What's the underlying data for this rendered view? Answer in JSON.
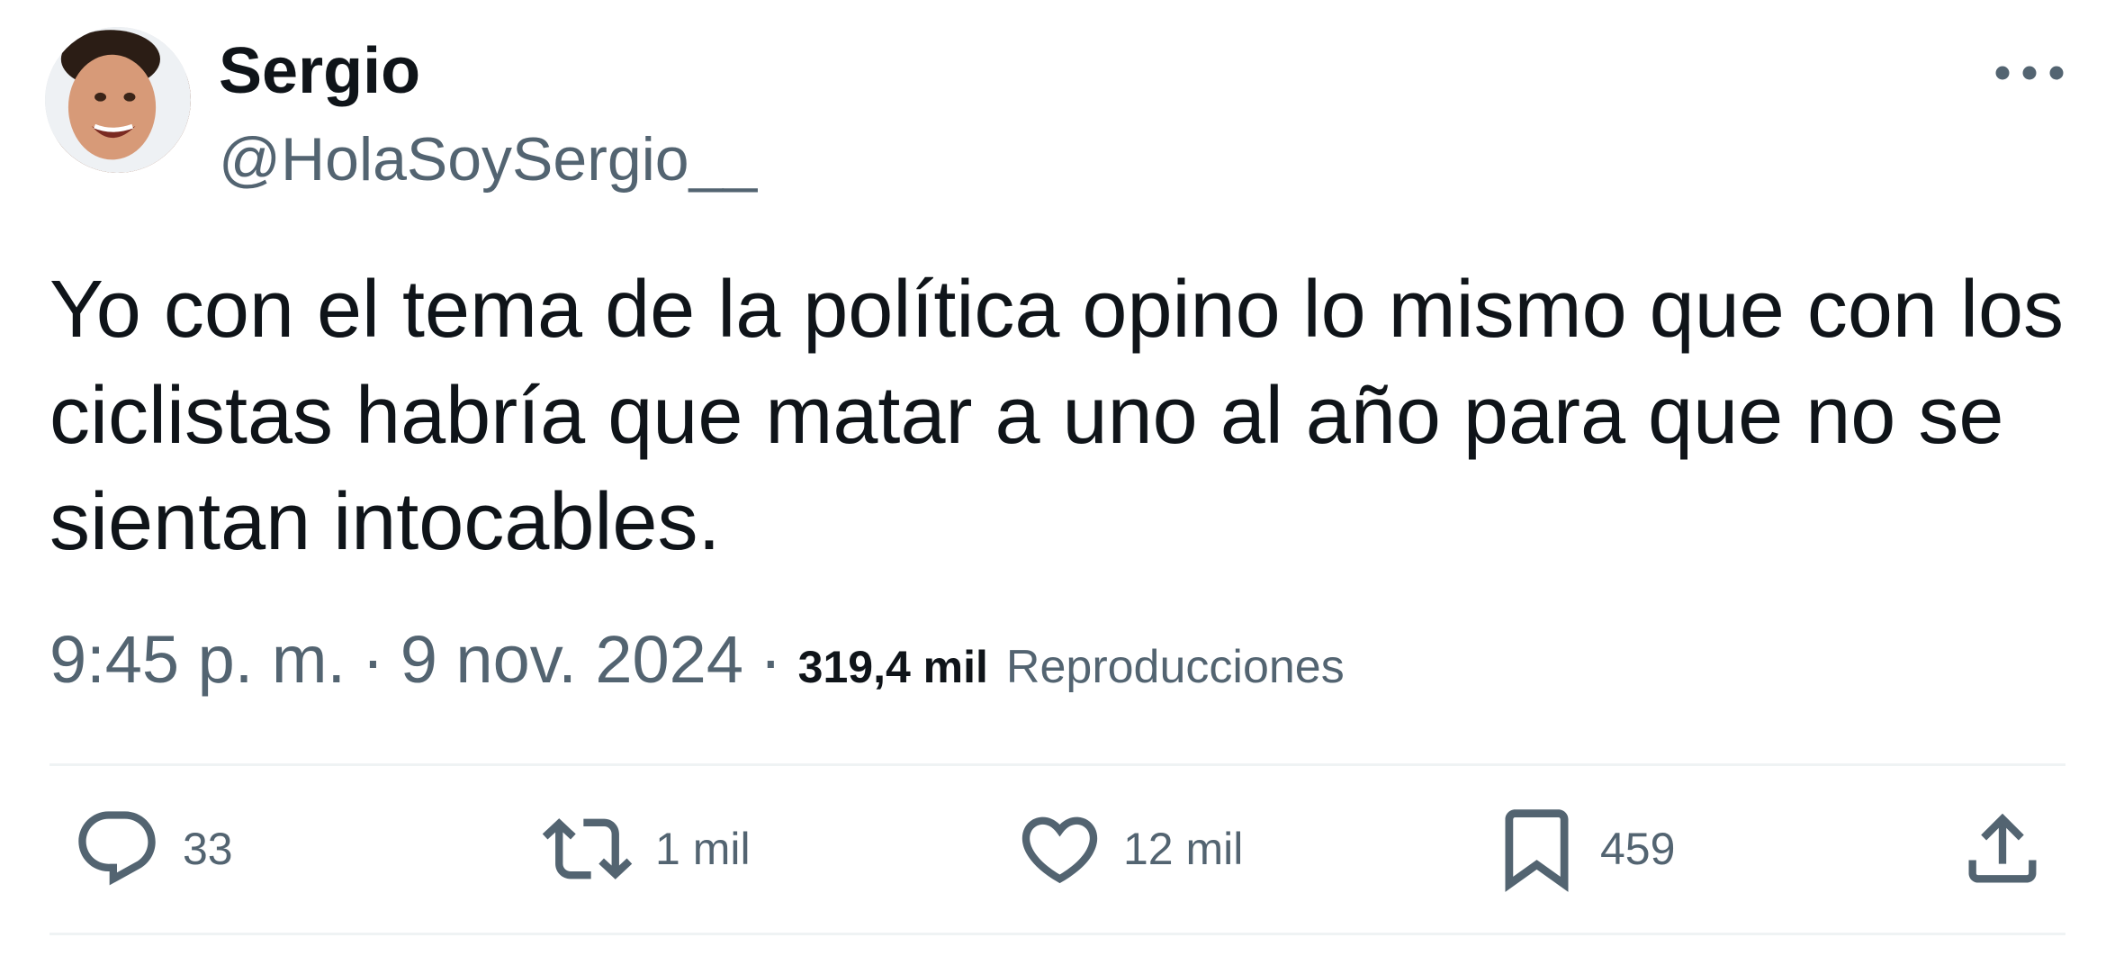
{
  "author": {
    "name": "Sergio",
    "handle": "@HolaSoySergio__"
  },
  "tweet": {
    "text": "Yo con el tema de la política opino lo mismo que con los ciclistas habría que matar a uno al año para que no se sientan intocables.",
    "time": "9:45 p. m.",
    "separator": "·",
    "date": "9 nov. 2024",
    "views_count": "319,4 mil",
    "views_label": "Reproducciones"
  },
  "actions": {
    "replies": "33",
    "retweets": "1 mil",
    "likes": "12 mil",
    "bookmarks": "459"
  },
  "icons": {
    "more": "more-horizontal-icon",
    "reply": "reply-icon",
    "retweet": "retweet-icon",
    "like": "heart-icon",
    "bookmark": "bookmark-icon",
    "share": "share-icon"
  },
  "colors": {
    "text_primary": "#0f1419",
    "text_secondary": "#536471",
    "divider": "#eff3f4"
  }
}
